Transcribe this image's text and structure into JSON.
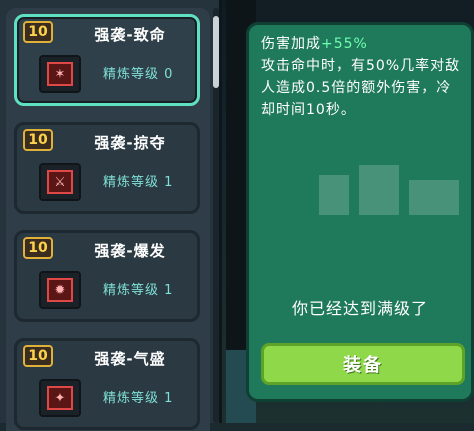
{
  "weapon_list": {
    "items": [
      {
        "level": "10",
        "name": "强袭-致命",
        "refine_label": "精炼等级",
        "refine_level": "0",
        "selected": true
      },
      {
        "level": "10",
        "name": "强袭-掠夺",
        "refine_label": "精炼等级",
        "refine_level": "1",
        "selected": false
      },
      {
        "level": "10",
        "name": "强袭-爆发",
        "refine_label": "精炼等级",
        "refine_level": "1",
        "selected": false
      },
      {
        "level": "10",
        "name": "强袭-气盛",
        "refine_label": "精炼等级",
        "refine_level": "1",
        "selected": false
      }
    ]
  },
  "detail": {
    "bonus_label": "伤害加成",
    "bonus_value": "+55%",
    "description": "攻击命中时，有50%几率对敌人造成0.5倍的额外伤害，冷却时间10秒。",
    "maxed_text": "你已经达到满级了",
    "equip_label": "装备"
  },
  "colors": {
    "selected_border": "#5fe0c0",
    "level_badge": "#ffd24a",
    "detail_panel": "#1f7a5c",
    "bonus_text": "#6fffb0",
    "equip_button": "#8fd84a",
    "refine_text": "#7fe0d6"
  },
  "icons": {
    "item_icon": "red-attack-icon"
  }
}
